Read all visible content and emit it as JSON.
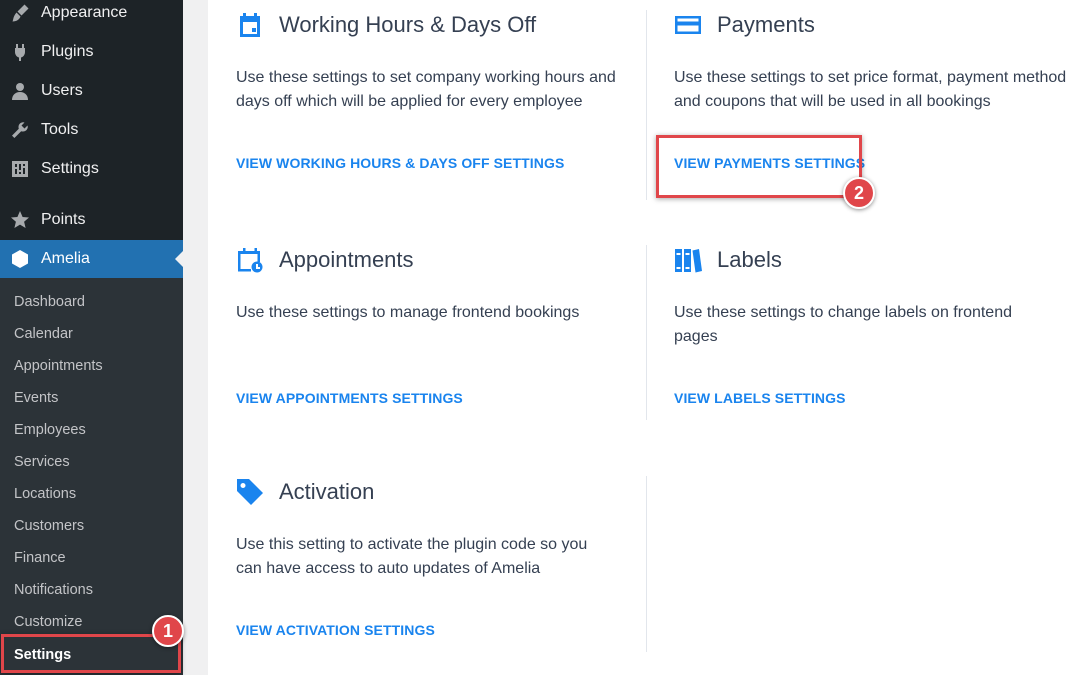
{
  "sidebar": {
    "top_items": [
      {
        "label": "Appearance",
        "icon": "paintbrush-icon"
      },
      {
        "label": "Plugins",
        "icon": "plug-icon"
      },
      {
        "label": "Users",
        "icon": "user-icon"
      },
      {
        "label": "Tools",
        "icon": "wrench-icon"
      },
      {
        "label": "Settings",
        "icon": "sliders-icon"
      },
      {
        "label": "Points",
        "icon": "star-icon"
      },
      {
        "label": "Amelia",
        "icon": "amelia-logo-icon"
      }
    ],
    "sub_items": [
      "Dashboard",
      "Calendar",
      "Appointments",
      "Events",
      "Employees",
      "Services",
      "Locations",
      "Customers",
      "Finance",
      "Notifications",
      "Customize",
      "Settings"
    ],
    "active_top_item": "Amelia",
    "current_sub_item": "Settings"
  },
  "cards": {
    "working_hours": {
      "icon": "calendar-icon",
      "title": "Working Hours & Days Off",
      "description": "Use these settings to set company working hours and days off which will be applied for every employee",
      "link": "VIEW WORKING HOURS & DAYS OFF SETTINGS"
    },
    "payments": {
      "icon": "credit-card-icon",
      "title": "Payments",
      "description": "Use these settings to set price format, payment method and coupons that will be used in all bookings",
      "link": "VIEW PAYMENTS SETTINGS"
    },
    "appointments": {
      "icon": "calendar-clock-icon",
      "title": "Appointments",
      "description": "Use these settings to manage frontend bookings",
      "link": "VIEW APPOINTMENTS SETTINGS"
    },
    "labels": {
      "icon": "books-icon",
      "title": "Labels",
      "description": "Use these settings to change labels on frontend pages",
      "link": "VIEW LABELS SETTINGS"
    },
    "activation": {
      "icon": "tag-icon",
      "title": "Activation",
      "description": "Use this setting to activate the plugin code so you can have access to auto updates of Amelia",
      "link": "VIEW ACTIVATION SETTINGS"
    }
  },
  "annotations": {
    "step1": "1",
    "step2": "2",
    "color": "#e0464a"
  },
  "colors": {
    "sidebar_bg": "#1d2327",
    "submenu_bg": "#2c3338",
    "active_bg": "#2271b1",
    "accent": "#1a84ee",
    "text": "#354052"
  }
}
